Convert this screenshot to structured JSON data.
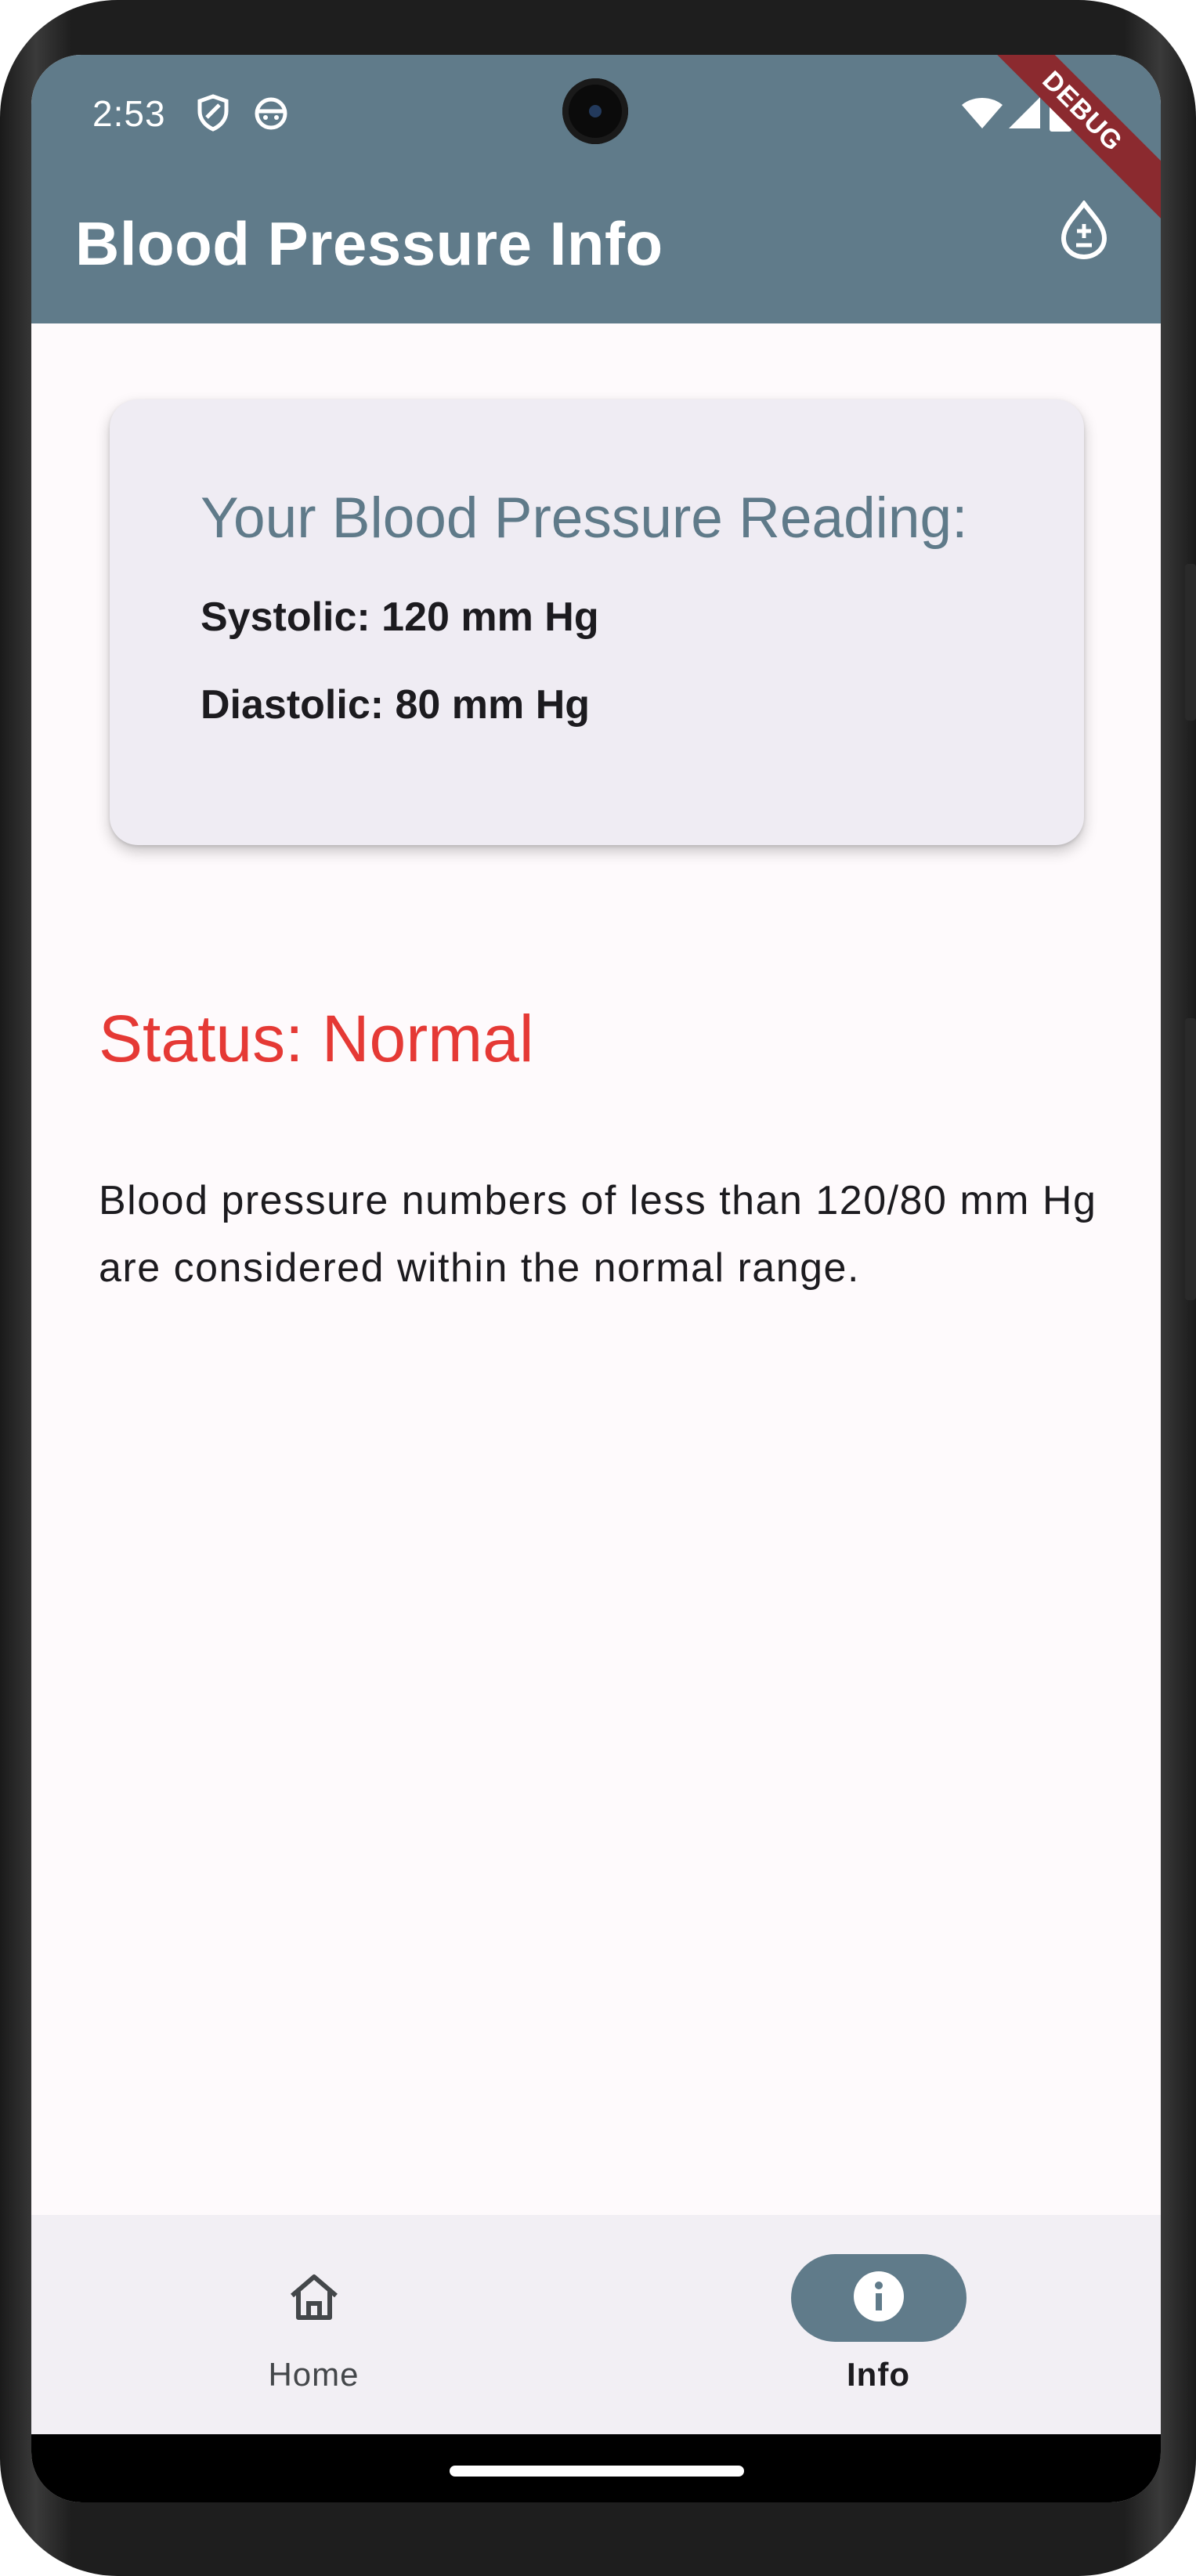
{
  "status_bar": {
    "time": "2:53",
    "icons": [
      "shield-icon",
      "android-face-icon",
      "wifi-icon",
      "signal-icon",
      "battery-icon"
    ]
  },
  "debug_banner": "DEBUG",
  "app_bar": {
    "title": "Blood Pressure Info",
    "action_icon": "blood-drop-plus-minus-icon"
  },
  "reading_card": {
    "title": "Your Blood Pressure Reading:",
    "systolic": "Systolic: 120 mm Hg",
    "diastolic": "Diastolic: 80 mm Hg"
  },
  "status": {
    "label": "Status: Normal",
    "color": "#e53935",
    "description": "Blood pressure numbers of less than 120/80 mm Hg are considered within the normal range."
  },
  "bottom_nav": {
    "items": [
      {
        "label": "Home",
        "icon": "home-icon",
        "active": false
      },
      {
        "label": "Info",
        "icon": "info-icon",
        "active": true
      }
    ]
  },
  "colors": {
    "primary": "#607b8a",
    "status_normal": "#e53935",
    "surface": "#fefafc",
    "card": "#efecf3"
  }
}
